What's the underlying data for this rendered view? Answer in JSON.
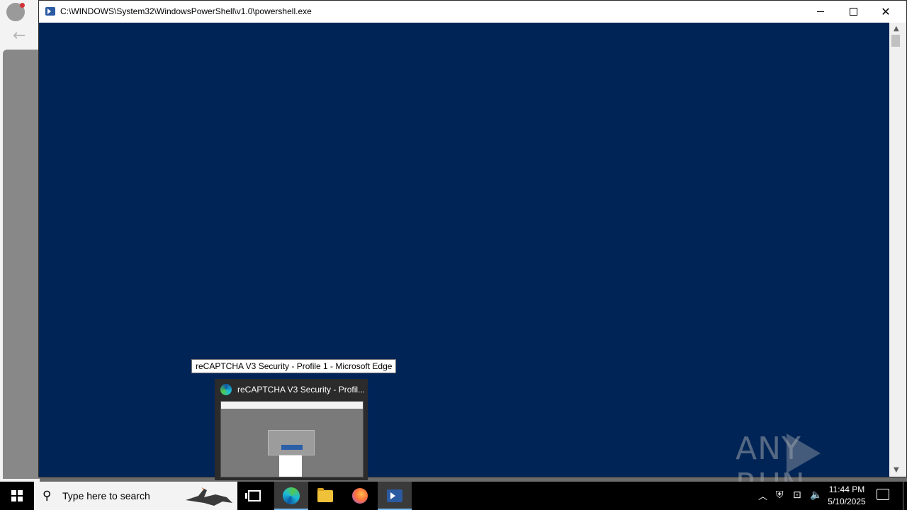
{
  "background_browser": {
    "back_icon": "arrow-left-icon"
  },
  "powershell_window": {
    "title": "C:\\WINDOWS\\System32\\WindowsPowerShell\\v1.0\\powershell.exe",
    "console_background": "#012456",
    "controls": {
      "minimize_icon": "minimize-icon",
      "maximize_icon": "maximize-icon",
      "close_icon": "close-icon"
    }
  },
  "watermark": {
    "text_left": "ANY",
    "text_right": "RUN"
  },
  "tooltip": {
    "text": "reCAPTCHA V3 Security - Profile 1 - Microsoft Edge"
  },
  "thumbnail": {
    "title": "reCAPTCHA V3 Security - Profil...",
    "app_icon": "edge-icon"
  },
  "taskbar": {
    "search_placeholder": "Type here to search",
    "apps": [
      {
        "name": "Task View",
        "icon": "task-view-icon"
      },
      {
        "name": "Microsoft Edge",
        "icon": "edge-icon",
        "active": true
      },
      {
        "name": "File Explorer",
        "icon": "folder-icon"
      },
      {
        "name": "Firefox",
        "icon": "firefox-icon"
      },
      {
        "name": "Windows PowerShell",
        "icon": "powershell-icon",
        "active": true
      }
    ],
    "clock": {
      "time": "11:44 PM",
      "date": "5/10/2025"
    },
    "accent_color": "#76b9ed"
  }
}
